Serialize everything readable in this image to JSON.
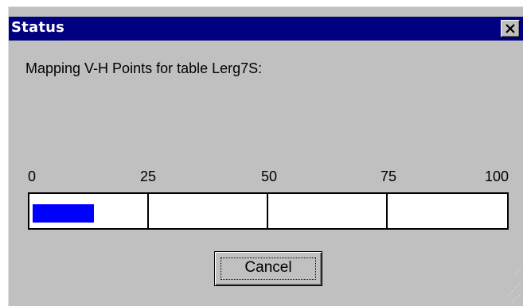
{
  "dialog": {
    "title": "Status",
    "close_icon": "close-icon",
    "message": "Mapping V-H Points for table Lerg7S:",
    "progress": {
      "value_percent": 13,
      "fill_color": "#0000ff",
      "ticks": [
        "0",
        "25",
        "50",
        "75",
        "100"
      ]
    },
    "cancel_label": "Cancel"
  },
  "colors": {
    "titlebar": "#000080",
    "face": "#c0c0c0"
  }
}
